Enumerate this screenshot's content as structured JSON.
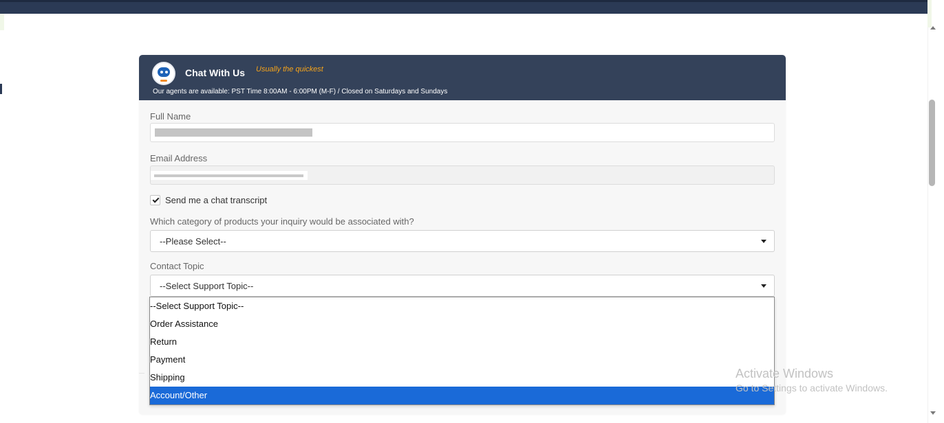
{
  "chat": {
    "title": "Chat With Us",
    "tagline": "Usually the quickest",
    "hours": "Our agents are available: PST Time 8:00AM - 6:00PM (M-F) / Closed on Saturdays and Sundays"
  },
  "form": {
    "full_name_label": "Full Name",
    "email_label": "Email Address",
    "transcript_label": "Send me a chat transcript",
    "transcript_checked": true,
    "category_label": "Which category of products your inquiry would be associated with?",
    "category_value": "--Please Select--",
    "topic_label": "Contact Topic",
    "topic_value": "--Select Support Topic--"
  },
  "topic_dropdown": {
    "options": [
      "--Select Support Topic--",
      "Order Assistance",
      "Return",
      "Payment",
      "Shipping",
      "Account/Other"
    ],
    "highlighted": "Account/Other"
  },
  "watermark": {
    "title": "Activate Windows",
    "subtitle": "Go to Settings to activate Windows."
  },
  "colors": {
    "header_bg": "#34425a",
    "tagline": "#f5a31a",
    "highlight": "#1a6ad8"
  }
}
